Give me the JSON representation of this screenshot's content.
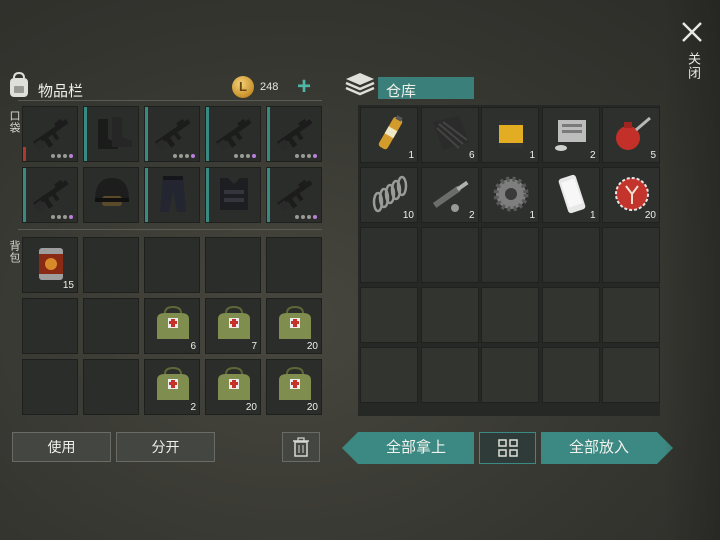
{
  "inventory": {
    "title": "物品栏",
    "coins": "248",
    "pocket_label": "口袋",
    "backpack_label": "背包",
    "pocket_slots": [
      {
        "icon": "rifle-icon",
        "rarity": "red"
      },
      {
        "icon": "boots-icon",
        "rarity": "teal"
      },
      {
        "icon": "rifle-icon",
        "rarity": "teal"
      },
      {
        "icon": "rifle-icon",
        "rarity": "teal"
      },
      {
        "icon": "rifle-icon",
        "rarity": "teal"
      },
      {
        "icon": "rifle-icon",
        "rarity": "teal"
      },
      {
        "icon": "helmet-icon",
        "rarity": "none"
      },
      {
        "icon": "pants-icon",
        "rarity": "teal"
      },
      {
        "icon": "vest-icon",
        "rarity": "teal"
      },
      {
        "icon": "rifle-icon",
        "rarity": "teal"
      }
    ],
    "backpack_slots": [
      {
        "icon": "canned-food-icon",
        "qty": "15"
      },
      {},
      {},
      {},
      {},
      {},
      {},
      {
        "icon": "medkit-bag-icon",
        "qty": "6"
      },
      {
        "icon": "medkit-bag-icon",
        "qty": "7"
      },
      {
        "icon": "medkit-bag-icon",
        "qty": "20"
      },
      {},
      {},
      {
        "icon": "medkit-bag-icon",
        "qty": "2"
      },
      {
        "icon": "medkit-bag-icon",
        "qty": "20"
      },
      {
        "icon": "medkit-bag-icon",
        "qty": "20"
      }
    ],
    "use_label": "使用",
    "split_label": "分开"
  },
  "warehouse": {
    "title": "仓库",
    "items": [
      {
        "icon": "adrenaline-vial-icon",
        "qty": "1"
      },
      {
        "icon": "rubber-mat-icon",
        "qty": "6"
      },
      {
        "icon": "oil-filter-icon",
        "qty": "1"
      },
      {
        "icon": "engine-block-icon",
        "qty": "2"
      },
      {
        "icon": "oil-can-icon",
        "qty": "5"
      },
      {
        "icon": "spring-icon",
        "qty": "10"
      },
      {
        "icon": "shock-absorber-icon",
        "qty": "2"
      },
      {
        "icon": "gear-icon",
        "qty": "1"
      },
      {
        "icon": "smartphone-icon",
        "qty": "1"
      },
      {
        "icon": "bottle-cap-icon",
        "qty": "20"
      }
    ],
    "take_all_label": "全部拿上",
    "put_all_label": "全部放入"
  },
  "close_label": "关闭",
  "colors": {
    "accent": "#3c8882",
    "rarity_red": "#b5362b",
    "rarity_teal": "#3a8a84",
    "purple_dot": "#b880d9"
  }
}
